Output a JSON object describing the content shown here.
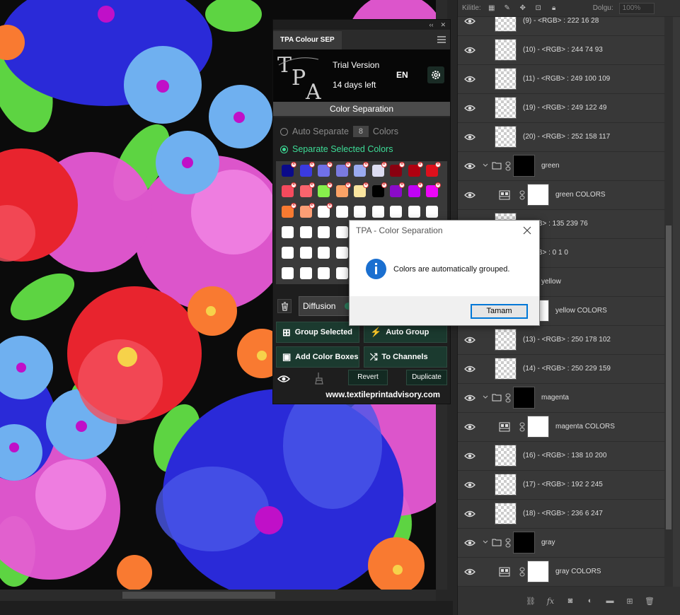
{
  "layers_toolbar": {
    "lock_label": "Kilitle:",
    "fill_label": "Dolgu:",
    "fill_value": "100%"
  },
  "layers": [
    {
      "type": "layer",
      "name": "(9) - <RGB> : 222 16 28"
    },
    {
      "type": "layer",
      "name": "(10) - <RGB> : 244 74 93"
    },
    {
      "type": "layer",
      "name": "(11) - <RGB> : 249 100 109"
    },
    {
      "type": "layer",
      "name": "(19) - <RGB> : 249 122 49"
    },
    {
      "type": "layer",
      "name": "(20) - <RGB> : 252 158 117"
    },
    {
      "type": "group",
      "name": "green"
    },
    {
      "type": "adj",
      "name": "green COLORS"
    },
    {
      "type": "layer",
      "name": "<RGB> : 135 239 76"
    },
    {
      "type": "layer",
      "name": "<RGB> : 0 1 0"
    },
    {
      "type": "group",
      "name": "yellow"
    },
    {
      "type": "adj",
      "name": "yellow COLORS"
    },
    {
      "type": "layer",
      "name": "(13) - <RGB> : 250 178 102"
    },
    {
      "type": "layer",
      "name": "(14) - <RGB> : 250 229 159"
    },
    {
      "type": "group",
      "name": "magenta"
    },
    {
      "type": "adj",
      "name": "magenta COLORS"
    },
    {
      "type": "layer",
      "name": "(16) - <RGB> : 138 10 200"
    },
    {
      "type": "layer",
      "name": "(17) - <RGB> : 192 2 245"
    },
    {
      "type": "layer",
      "name": "(18) - <RGB> : 236 6 247"
    },
    {
      "type": "group",
      "name": "gray"
    },
    {
      "type": "adj",
      "name": "gray COLORS"
    }
  ],
  "tpa": {
    "tab_title": "TPA Colour SEP",
    "trial_text": "Trial Version",
    "days_left": "14 days left",
    "language": "EN",
    "section_title": "Color Separation",
    "auto_separate_label": "Auto Separate",
    "auto_separate_count": "8",
    "colors_label": "Colors",
    "separate_selected_label": "Separate Selected Colors",
    "diffusion_label": "Diffusion",
    "group_selected_label": "Group Selected",
    "auto_group_label": "Auto Group",
    "add_color_boxes_label": "Add Color Boxes",
    "to_channels_label": "To Channels",
    "revert_label": "Revert",
    "duplicate_label": "Duplicate",
    "website": "www.textileprintadvisory.com",
    "swatches": [
      {
        "color": "#0a0a8a",
        "x": true
      },
      {
        "color": "#3a3ae0",
        "x": true
      },
      {
        "color": "#7070e8",
        "x": true
      },
      {
        "color": "#7a7ae0",
        "x": true
      },
      {
        "color": "#9aaaf0",
        "x": true
      },
      {
        "color": "#dcdcf0",
        "x": true
      },
      {
        "color": "#8a0010",
        "x": true
      },
      {
        "color": "#b00010",
        "x": true
      },
      {
        "color": "#de101c",
        "x": true
      },
      {
        "color": "#f44a5d",
        "x": true
      },
      {
        "color": "#f9646d",
        "x": true
      },
      {
        "color": "#87ef4c",
        "x": true
      },
      {
        "color": "#faa266",
        "x": true
      },
      {
        "color": "#fae59f",
        "x": true
      },
      {
        "color": "#000100",
        "x": true
      },
      {
        "color": "#8a0ac8",
        "x": true
      },
      {
        "color": "#c002f5",
        "x": true
      },
      {
        "color": "#ec06f7",
        "x": true
      },
      {
        "color": "#f97a31",
        "x": true
      },
      {
        "color": "#fc9e75",
        "x": true
      },
      {
        "color": "#ffffff",
        "x": true
      },
      {
        "color": "#ffffff",
        "x": false
      },
      {
        "color": "#ffffff",
        "x": false
      },
      {
        "color": "#ffffff",
        "x": false
      },
      {
        "color": "#ffffff",
        "x": false
      },
      {
        "color": "#ffffff",
        "x": false
      },
      {
        "color": "#ffffff",
        "x": false
      },
      {
        "color": "#ffffff",
        "x": false
      },
      {
        "color": "#ffffff",
        "x": false
      },
      {
        "color": "#ffffff",
        "x": false
      },
      {
        "color": "#ffffff",
        "x": false
      },
      {
        "color": "#ffffff",
        "x": false
      },
      {
        "color": "#ffffff",
        "x": false
      },
      {
        "color": "#ffffff",
        "x": false
      },
      {
        "color": "#ffffff",
        "x": false
      },
      {
        "color": "#ffffff",
        "x": false
      },
      {
        "color": "#ffffff",
        "x": false
      },
      {
        "color": "#ffffff",
        "x": false
      },
      {
        "color": "#ffffff",
        "x": false
      },
      {
        "color": "#ffffff",
        "x": false
      },
      {
        "color": "#ffffff",
        "x": false
      },
      {
        "color": "#ffffff",
        "x": false
      },
      {
        "color": "#ffffff",
        "x": false
      },
      {
        "color": "#ffffff",
        "x": false
      },
      {
        "color": "#ffffff",
        "x": false
      },
      {
        "color": "#ffffff",
        "x": false
      },
      {
        "color": "#ffffff",
        "x": false
      },
      {
        "color": "#ffffff",
        "x": false
      },
      {
        "color": "#ffffff",
        "x": false
      },
      {
        "color": "#ffffff",
        "x": false
      },
      {
        "color": "#ffffff",
        "x": false
      },
      {
        "color": "#ffffff",
        "x": false
      },
      {
        "color": "#ffffff",
        "x": false
      },
      {
        "color": "#ffffff",
        "x": false
      }
    ]
  },
  "dialog": {
    "title": "TPA - Color Separation",
    "message": "Colors are automatically grouped.",
    "ok_label": "Tamam"
  },
  "colors": {
    "accent_green": "#3ddc97",
    "dialog_focus": "#0078d7"
  }
}
